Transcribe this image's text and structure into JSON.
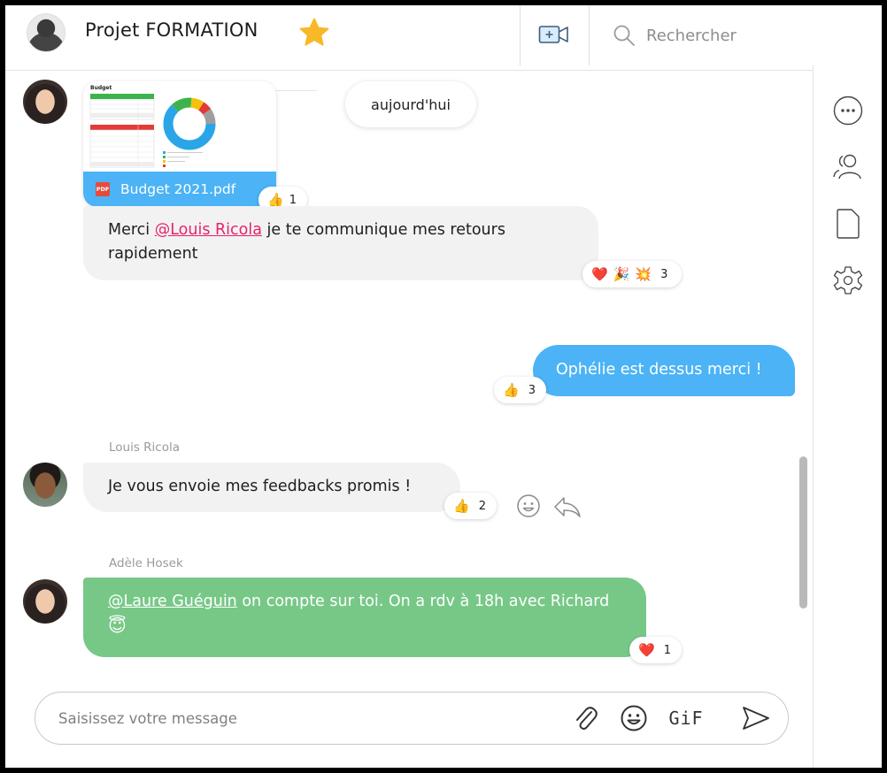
{
  "header": {
    "title": "Projet FORMATION",
    "search_placeholder": "Rechercher",
    "icons": {
      "favorite": "star-icon",
      "video": "video-call-icon",
      "search": "search-icon"
    }
  },
  "sidebar": {
    "icons": [
      "more-options-icon",
      "members-icon",
      "files-icon",
      "settings-icon"
    ]
  },
  "date_separator": "aujourd'hui",
  "attachment": {
    "file_name": "Budget 2021.pdf",
    "file_type": "PDF",
    "preview_title": "Budget",
    "reaction": {
      "emoji": "👍",
      "count": "1"
    }
  },
  "messages": [
    {
      "id": "m1",
      "sender": "",
      "mention": "@Louis Ricola",
      "text_after": " je te communique mes retours rapidement",
      "reactions": {
        "emojis": [
          "❤️",
          "🎉",
          "💥"
        ],
        "count": "3"
      }
    },
    {
      "id": "m2",
      "outgoing": true,
      "text": "Ophélie est dessus merci !",
      "reactions": {
        "emojis": [
          "👍"
        ],
        "count": "3"
      }
    },
    {
      "id": "m3",
      "sender": "Louis Ricola",
      "text": "Je vous envoie mes feedbacks promis !",
      "reactions": {
        "emojis": [
          "👍"
        ],
        "count": "2"
      }
    },
    {
      "id": "m4",
      "sender": "Adèle Hosek",
      "mention": "@Laure Guéguin",
      "text_after": " on compte sur toi. On a rdv à 18h avec Richard ",
      "emoji": "😇",
      "reactions": {
        "emojis": [
          "❤️"
        ],
        "count": "1"
      }
    }
  ],
  "m1_prefix": "Merci ",
  "composer": {
    "placeholder": "Saisissez votre message",
    "gif_label": "GiF"
  },
  "colors": {
    "accent_blue": "#4bb3f6",
    "accent_green": "#77c887",
    "mention_pink": "#e8226c",
    "star_yellow": "#f7b928",
    "incoming_bubble": "#f2f2f2"
  }
}
